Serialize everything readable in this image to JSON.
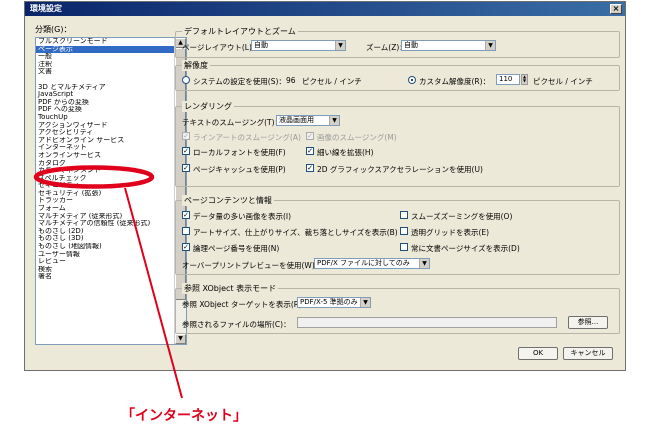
{
  "window": {
    "title": "環境設定",
    "close_glyph": "×"
  },
  "categories": {
    "label": "分類(G)：",
    "items": [
      "フルスクリーンモード",
      "ページ表示",
      "一般",
      "注釈",
      "文書",
      "",
      "3D とマルチメディア",
      "JavaScript",
      "PDF からの変換",
      "PDF への変換",
      "TouchUp",
      "アクションウィザード",
      "アクセシビリティ",
      "アドビオンライン サービス",
      "インターネット",
      "オンラインサービス",
      "カタログ",
      "カラーマネジメント",
      "スペルチェック",
      "セキュリティ",
      "セキュリティ (拡張)",
      "トラッカー",
      "フォーム",
      "マルチメディア (従来形式)",
      "マルチメディアの信頼性 (従来形式)",
      "ものさし (2D)",
      "ものさし (3D)",
      "ものさし (地図情報)",
      "ユーザー情報",
      "レビュー",
      "検索",
      "署名"
    ],
    "selected_index": 1
  },
  "layout_zoom": {
    "legend": "デフォルトレイアウトとズーム",
    "page_layout_label": "ページレイアウト(L)：",
    "page_layout_value": "自動",
    "zoom_label": "ズーム(Z)：",
    "zoom_value": "自動"
  },
  "resolution": {
    "legend": "解像度",
    "system_label": "システムの設定を使用(S)：",
    "system_value": "96",
    "system_unit": "ピクセル / インチ",
    "custom_label": "カスタム解像度(R)：",
    "custom_value": "110",
    "custom_unit": "ピクセル / インチ",
    "selected": "custom"
  },
  "rendering": {
    "legend": "レンダリング",
    "smoothing_label": "テキストのスムージング(T)：",
    "smoothing_value": "液晶画面用",
    "options": [
      {
        "label": "ラインアートのスムージング(A)",
        "checked": true,
        "disabled": true
      },
      {
        "label": "画像のスムージング(M)",
        "checked": true,
        "disabled": true
      },
      {
        "label": "ローカルフォントを使用(F)",
        "checked": true,
        "disabled": false
      },
      {
        "label": "細い線を拡張(H)",
        "checked": true,
        "disabled": false
      },
      {
        "label": "ページキャッシュを使用(P)",
        "checked": true,
        "disabled": false
      },
      {
        "label": "2D グラフィックスアクセラレーションを使用(U)",
        "checked": true,
        "disabled": false
      }
    ]
  },
  "page_content": {
    "legend": "ページコンテンツと情報",
    "options": [
      {
        "label": "データ量の多い画像を表示(I)",
        "checked": true
      },
      {
        "label": "スムーズズーミングを使用(O)",
        "checked": false
      },
      {
        "label": "アートサイズ、仕上がりサイズ、裁ち落としサイズを表示(B)",
        "checked": false
      },
      {
        "label": "透明グリッドを表示(E)",
        "checked": false
      },
      {
        "label": "論理ページ番号を使用(N)",
        "checked": true
      },
      {
        "label": "常に文書ページサイズを表示(D)",
        "checked": false
      }
    ],
    "overprint_label": "オーバープリントプレビューを使用(W)：",
    "overprint_value": "PDF/X ファイルに対してのみ"
  },
  "xobject": {
    "legend": "参照 XObject 表示モード",
    "target_label": "参照 XObject ターゲットを表示(R)：",
    "target_value": "PDF/X-5 準拠のみ",
    "file_label": "参照されるファイルの場所(C)：",
    "browse_label": "参照..."
  },
  "buttons": {
    "ok": "OK",
    "cancel": "キャンセル"
  },
  "annotation": {
    "caption": "「インターネット」",
    "color": "#e0001b"
  }
}
